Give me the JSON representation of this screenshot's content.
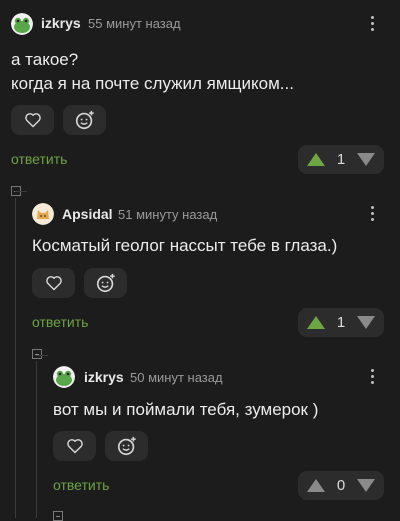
{
  "comments": [
    {
      "author": "izkrys",
      "time": "55 минут назад",
      "lines": [
        "а такое?",
        "когда я на почте служил ямщиком..."
      ],
      "reply": "ответить",
      "rating": "1",
      "voted_up": true,
      "avatar_icon": "frog-avatar"
    },
    {
      "author": "Apsidal",
      "time": "51 минуту назад",
      "lines": [
        "Косматый геолог нассыт тебе в глаза.)"
      ],
      "reply": "ответить",
      "rating": "1",
      "voted_up": true,
      "avatar_icon": "cat-avatar"
    },
    {
      "author": "izkrys",
      "time": "50 минут назад",
      "lines": [
        "вот мы и поймали тебя, зумерок )"
      ],
      "reply": "ответить",
      "rating": "0",
      "voted_up": false,
      "avatar_icon": "frog-avatar"
    }
  ],
  "colors": {
    "accent": "#6ea543",
    "background": "#1c1c1c",
    "pill": "#2c2c2c"
  }
}
